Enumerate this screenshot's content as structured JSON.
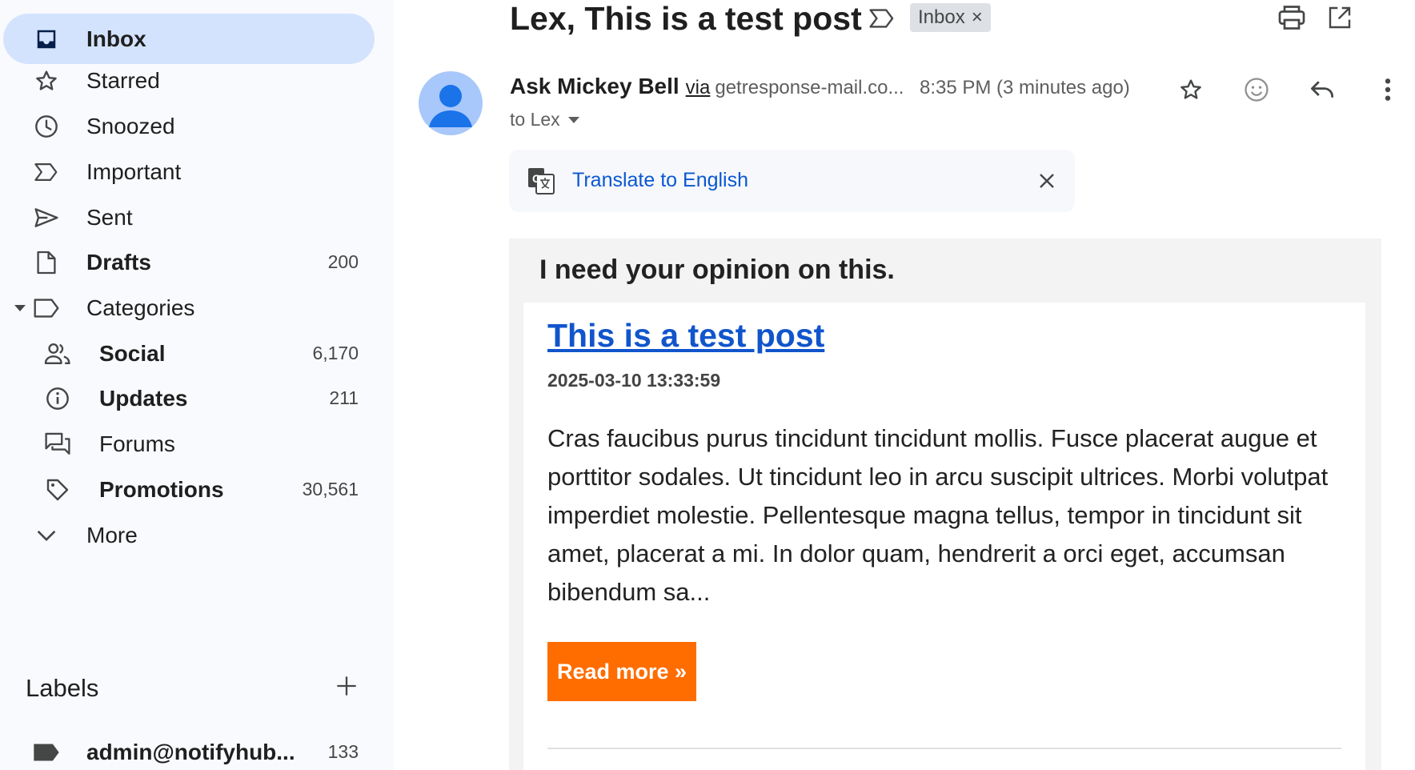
{
  "sidebar": {
    "items": [
      {
        "label": "Inbox",
        "count": "",
        "icon": "inbox-icon"
      },
      {
        "label": "Starred",
        "count": "",
        "icon": "star-icon"
      },
      {
        "label": "Snoozed",
        "count": "",
        "icon": "clock-icon"
      },
      {
        "label": "Important",
        "count": "",
        "icon": "important-icon"
      },
      {
        "label": "Sent",
        "count": "",
        "icon": "send-icon"
      },
      {
        "label": "Drafts",
        "count": "200",
        "icon": "draft-icon"
      },
      {
        "label": "Categories",
        "count": "",
        "icon": "label-icon"
      },
      {
        "label": "Social",
        "count": "6,170",
        "icon": "people-icon"
      },
      {
        "label": "Updates",
        "count": "211",
        "icon": "info-icon"
      },
      {
        "label": "Forums",
        "count": "",
        "icon": "forum-icon"
      },
      {
        "label": "Promotions",
        "count": "30,561",
        "icon": "tag-icon"
      },
      {
        "label": "More",
        "count": "",
        "icon": "chevron-down-icon"
      }
    ],
    "labels_title": "Labels",
    "user_labels": [
      {
        "label": "admin@notifyhub...",
        "count": "133",
        "icon": "label-filled-icon"
      }
    ]
  },
  "email": {
    "subject": "Lex, This is a test post",
    "chip_label": "Inbox",
    "chip_close": "×",
    "sender_name": "Ask Mickey Bell",
    "via": "via",
    "sender_domain": "getresponse-mail.co...",
    "timestamp": "8:35 PM (3 minutes ago)",
    "recipient": "to Lex",
    "translate_label": "Translate to English"
  },
  "body": {
    "preheader": "I need your opinion on this.",
    "post_title": "This is a test post",
    "post_date": "2025-03-10 13:33:59",
    "post_text": "Cras faucibus purus tincidunt tincidunt mollis. Fusce placerat augue et porttitor sodales. Ut tincidunt leo in arcu suscipit ultrices. Morbi volutpat imperdiet molestie. Pellentesque magna tellus, tempor in tincidunt sit amet, placerat a mi. In dolor quam, hendrerit a orci eget, accumsan bibendum sa...",
    "read_more": "Read more »"
  },
  "colors": {
    "active_nav": "#d3e3fd",
    "sidebar_bg": "#f8fafd",
    "link_blue": "#1155cc",
    "translate_blue": "#0b57d0",
    "button_orange": "#ff6d00",
    "chip_bg": "#dde1e5"
  }
}
